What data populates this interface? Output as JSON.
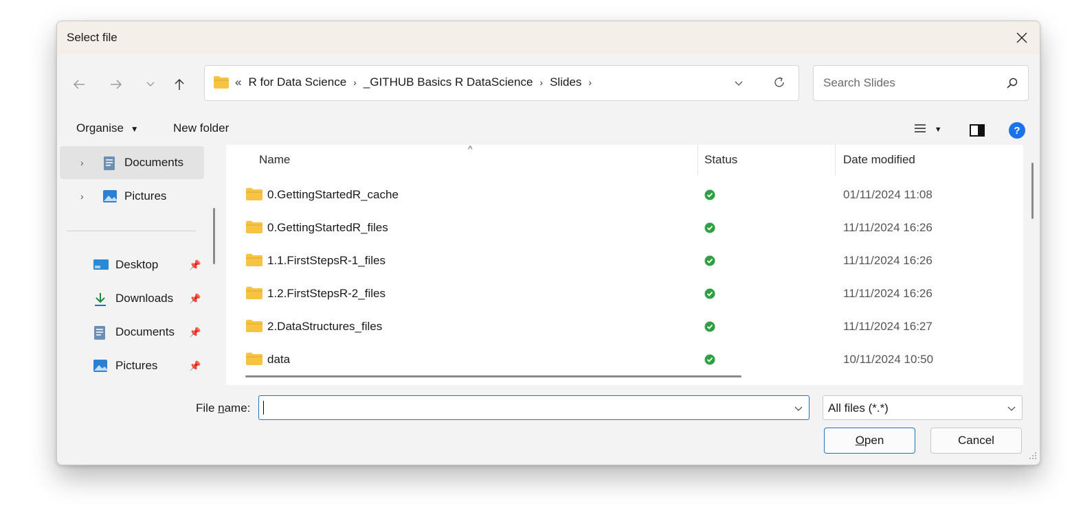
{
  "window": {
    "title": "Select file"
  },
  "address": {
    "overflow": "«",
    "crumbs": [
      "R for Data Science",
      "_GITHUB Basics R DataScience",
      "Slides"
    ]
  },
  "search": {
    "placeholder": "Search Slides"
  },
  "toolbar": {
    "organise": "Organise",
    "new_folder": "New folder"
  },
  "sidebar": {
    "tree": [
      {
        "label": "Documents",
        "icon": "documents-icon",
        "active": true
      },
      {
        "label": "Pictures",
        "icon": "pictures-icon",
        "active": false
      }
    ],
    "quick_access": [
      {
        "label": "Desktop",
        "icon": "desktop-icon"
      },
      {
        "label": "Downloads",
        "icon": "downloads-icon"
      },
      {
        "label": "Documents",
        "icon": "documents-icon"
      },
      {
        "label": "Pictures",
        "icon": "pictures-icon"
      }
    ]
  },
  "table": {
    "columns": {
      "name": "Name",
      "status": "Status",
      "date": "Date modified"
    },
    "rows": [
      {
        "name": "0.GettingStartedR_cache",
        "date": "01/11/2024 11:08"
      },
      {
        "name": "0.GettingStartedR_files",
        "date": "11/11/2024 16:26"
      },
      {
        "name": "1.1.FirstStepsR-1_files",
        "date": "11/11/2024 16:26"
      },
      {
        "name": "1.2.FirstStepsR-2_files",
        "date": "11/11/2024 16:26"
      },
      {
        "name": "2.DataStructures_files",
        "date": "11/11/2024 16:27"
      },
      {
        "name": "data",
        "date": "10/11/2024 10:50"
      }
    ]
  },
  "bottom": {
    "file_name_label_pre": "File ",
    "file_name_label_u": "n",
    "file_name_label_post": "ame:",
    "file_name_value": "",
    "file_type": "All files (*.*)",
    "open_u": "O",
    "open_rest": "pen",
    "cancel": "Cancel"
  },
  "colors": {
    "accent": "#1a73c8",
    "folder": "#f6c343",
    "status_ok": "#2ea043",
    "help": "#1a73e8"
  }
}
